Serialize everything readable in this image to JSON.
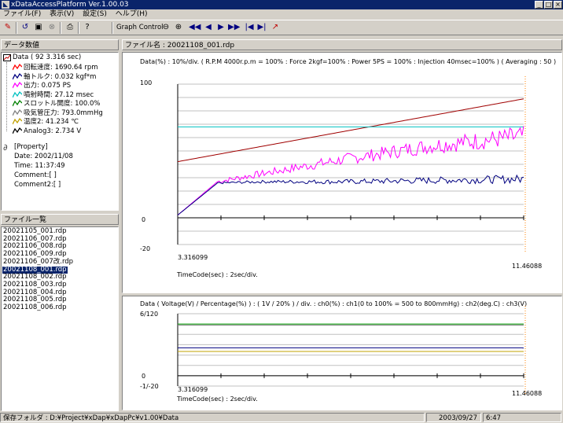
{
  "window": {
    "title": "xDataAccessPlatform Ver.1.00.03"
  },
  "menu": [
    "ファイル(F)",
    "表示(V)",
    "設定(S)",
    "ヘルプ(H)"
  ],
  "toolbar": {
    "graph_control_label": "Graph Control"
  },
  "left": {
    "data_header": "データ数値",
    "root_label": "Data ( 92 3.316 sec)",
    "channels": [
      {
        "label": "回転速度: 1690.64 rpm",
        "color": "#ff0000",
        "icon": "line-icon"
      },
      {
        "label": "軸トルク: 0.032 kgf*m",
        "color": "#000080",
        "icon": "line-icon"
      },
      {
        "label": "出力: 0.075 PS",
        "color": "#ff00ff",
        "icon": "line-icon"
      },
      {
        "label": "噴射時間: 27.12 msec",
        "color": "#00c0c0",
        "icon": "line-icon"
      },
      {
        "label": "スロットル開度: 100.0%",
        "color": "#008000",
        "icon": "line-icon"
      },
      {
        "label": "吸気管圧力: 793.0mmHg",
        "color": "#808080",
        "icon": "line-icon"
      },
      {
        "label": "温度2: 41.234 ℃",
        "color": "#c0a000",
        "icon": "line-icon"
      },
      {
        "label": "Analog3: 2.734 V",
        "color": "#000000",
        "icon": "line-icon"
      }
    ],
    "property": {
      "title": "[Property]",
      "date": "Date: 2002/11/08",
      "time": "Time: 11:37:49",
      "comment": "Comment:[ ]",
      "comment2": "Comment2:[ ]"
    },
    "files_header": "ファイル一覧",
    "files": [
      "20021105_001.rdp",
      "20021106_007.rdp",
      "20021106_008.rdp",
      "20021106_009.rdp",
      "20021106_007改.rdp",
      "20021108_001.rdp",
      "20021108_002.rdp",
      "20021108_003.rdp",
      "20021108_004.rdp",
      "20021108_005.rdp",
      "20021108_006.rdp"
    ],
    "selected_file": "20021108_001.rdp"
  },
  "right": {
    "file_header": "ファイル名 : 20021108_001.rdp",
    "chart1": {
      "desc": "Data(%) : 10%/div. ( R.P.M 4000r.p.m = 100% : Force 2kgf=100% : Power 5PS = 100% : Injection 40msec=100% ) ( Averaging : 50 )",
      "y_top": "100",
      "y_zero": "0",
      "y_bottom": "-20",
      "x_start": "3.316099",
      "x_end": "11.46088",
      "timecode": "TimeCode(sec) :  2sec/div."
    },
    "chart2": {
      "desc": "Data ( Voltage(V) / Percentage(%) ) : ( 1V / 20% ) / div. : ch0(%) : ch1(0 to 100% = 500 to 800mmHg) : ch2(deg.C) : ch3(V)",
      "y_top": "6/120",
      "y_zero": "0",
      "y_bottom": "-1/-20",
      "x_start": "3.316099",
      "x_end": "11.46088",
      "timecode": "TimeCode(sec) :  2sec/div."
    }
  },
  "chart_data": [
    {
      "type": "line",
      "title": "Data(%) : 10%/div.",
      "xlabel": "TimeCode(sec) :  2sec/div.",
      "ylabel": "Data(%)",
      "xlim": [
        3.316099,
        11.46088
      ],
      "ylim": [
        -20,
        100
      ],
      "series": [
        {
          "name": "回転速度",
          "color": "#a00000",
          "x": [
            3.316,
            11.46
          ],
          "values": [
            42,
            89
          ]
        },
        {
          "name": "噴射時間",
          "color": "#00c0c0",
          "x": [
            3.316,
            11.46
          ],
          "values": [
            68,
            68
          ]
        },
        {
          "name": "出力",
          "color": "#ff00ff",
          "x": [
            3.316,
            4.25,
            5.3,
            7.3,
            9.3,
            11.46
          ],
          "values": [
            2,
            27,
            33,
            44,
            54,
            61
          ]
        },
        {
          "name": "軸トルク",
          "color": "#000080",
          "x": [
            3.316,
            4.25,
            5.3,
            7.3,
            9.3,
            11.46
          ],
          "values": [
            2,
            26,
            27,
            27,
            28,
            29
          ]
        }
      ]
    },
    {
      "type": "line",
      "title": "Data ( Voltage(V) / Percentage(%) )",
      "xlabel": "TimeCode(sec) :  2sec/div.",
      "xlim": [
        3.316099,
        11.46088
      ],
      "ylim": [
        -20,
        120
      ],
      "series": [
        {
          "name": "ch0",
          "color": "#00a000",
          "x": [
            3.316,
            11.46
          ],
          "values": [
            100,
            100
          ]
        },
        {
          "name": "ch1",
          "color": "#808080",
          "x": [
            3.316,
            11.46
          ],
          "values": [
            98,
            98
          ]
        },
        {
          "name": "ch2",
          "color": "#c0a000",
          "x": [
            3.316,
            11.46
          ],
          "values": [
            47,
            47
          ]
        },
        {
          "name": "ch3",
          "color": "#000080",
          "x": [
            3.316,
            11.46
          ],
          "values": [
            54,
            54
          ]
        }
      ]
    }
  ],
  "status": {
    "folder": "保存フォルダ :  D:¥Project¥xDap¥xDapPc¥v1.00¥Data",
    "date": "2003/09/27",
    "time": "6:47"
  }
}
